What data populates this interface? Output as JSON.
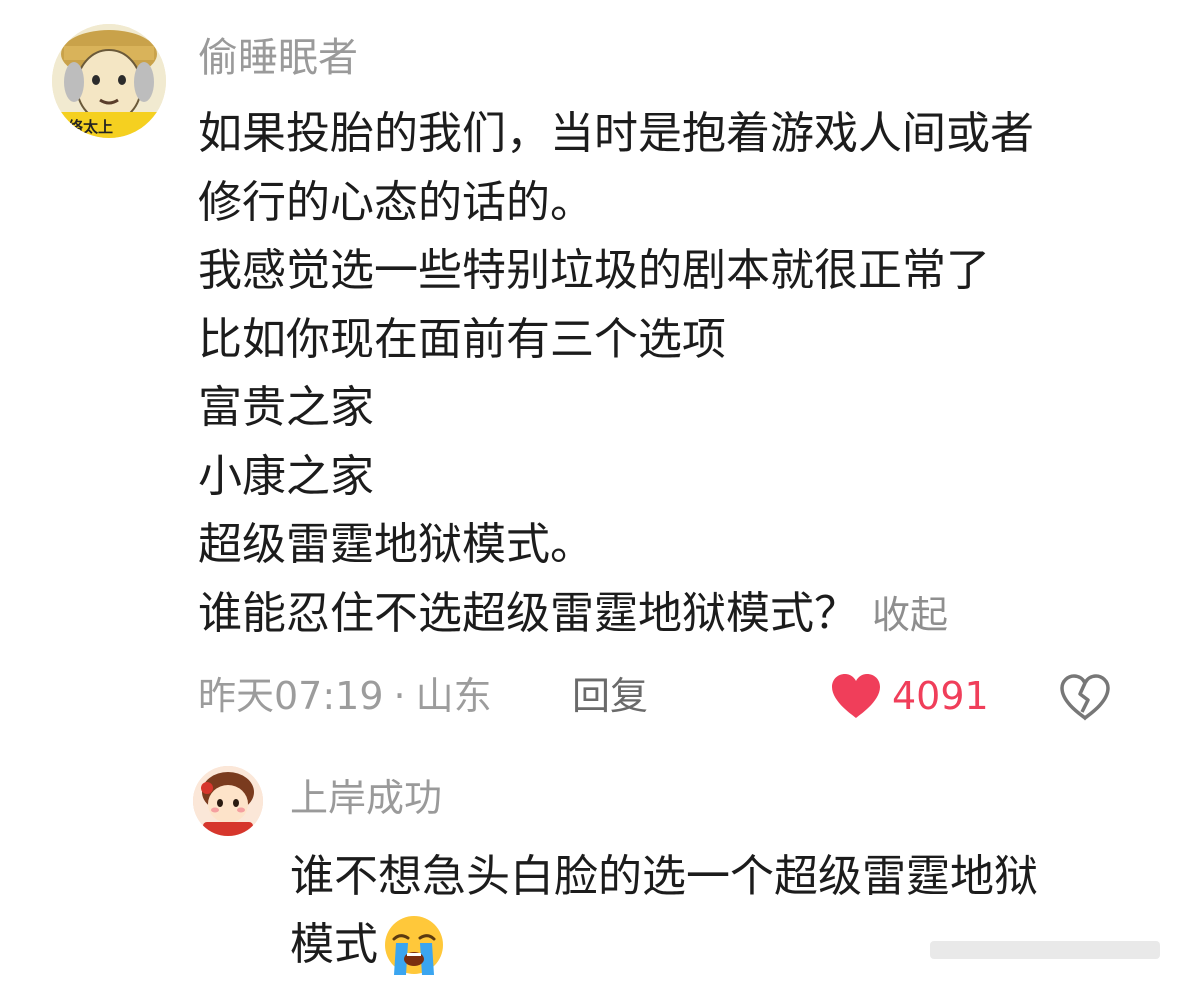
{
  "main_comment": {
    "username": "偷睡眠者",
    "avatar_caption": "络太上",
    "lines": [
      "如果投胎的我们，当时是抱着游戏人间或者",
      "修行的心态的话的。",
      "我感觉选一些特别垃圾的剧本就很正常了",
      "比如你现在面前有三个选项",
      "富贵之家",
      "小康之家",
      "超级雷霆地狱模式。",
      "谁能忍住不选超级雷霆地狱模式？"
    ],
    "collapse_label": "收起",
    "time": "昨天07:19",
    "separator": "·",
    "location": "山东",
    "reply_label": "回复",
    "like_count": "4091",
    "like_color": "#f03e5a"
  },
  "reply": {
    "username": "上岸成功",
    "lines": [
      "谁不想急头白脸的选一个超级雷霆地狱",
      "模式"
    ],
    "emoji_icon": "loudly-crying-face-icon"
  }
}
